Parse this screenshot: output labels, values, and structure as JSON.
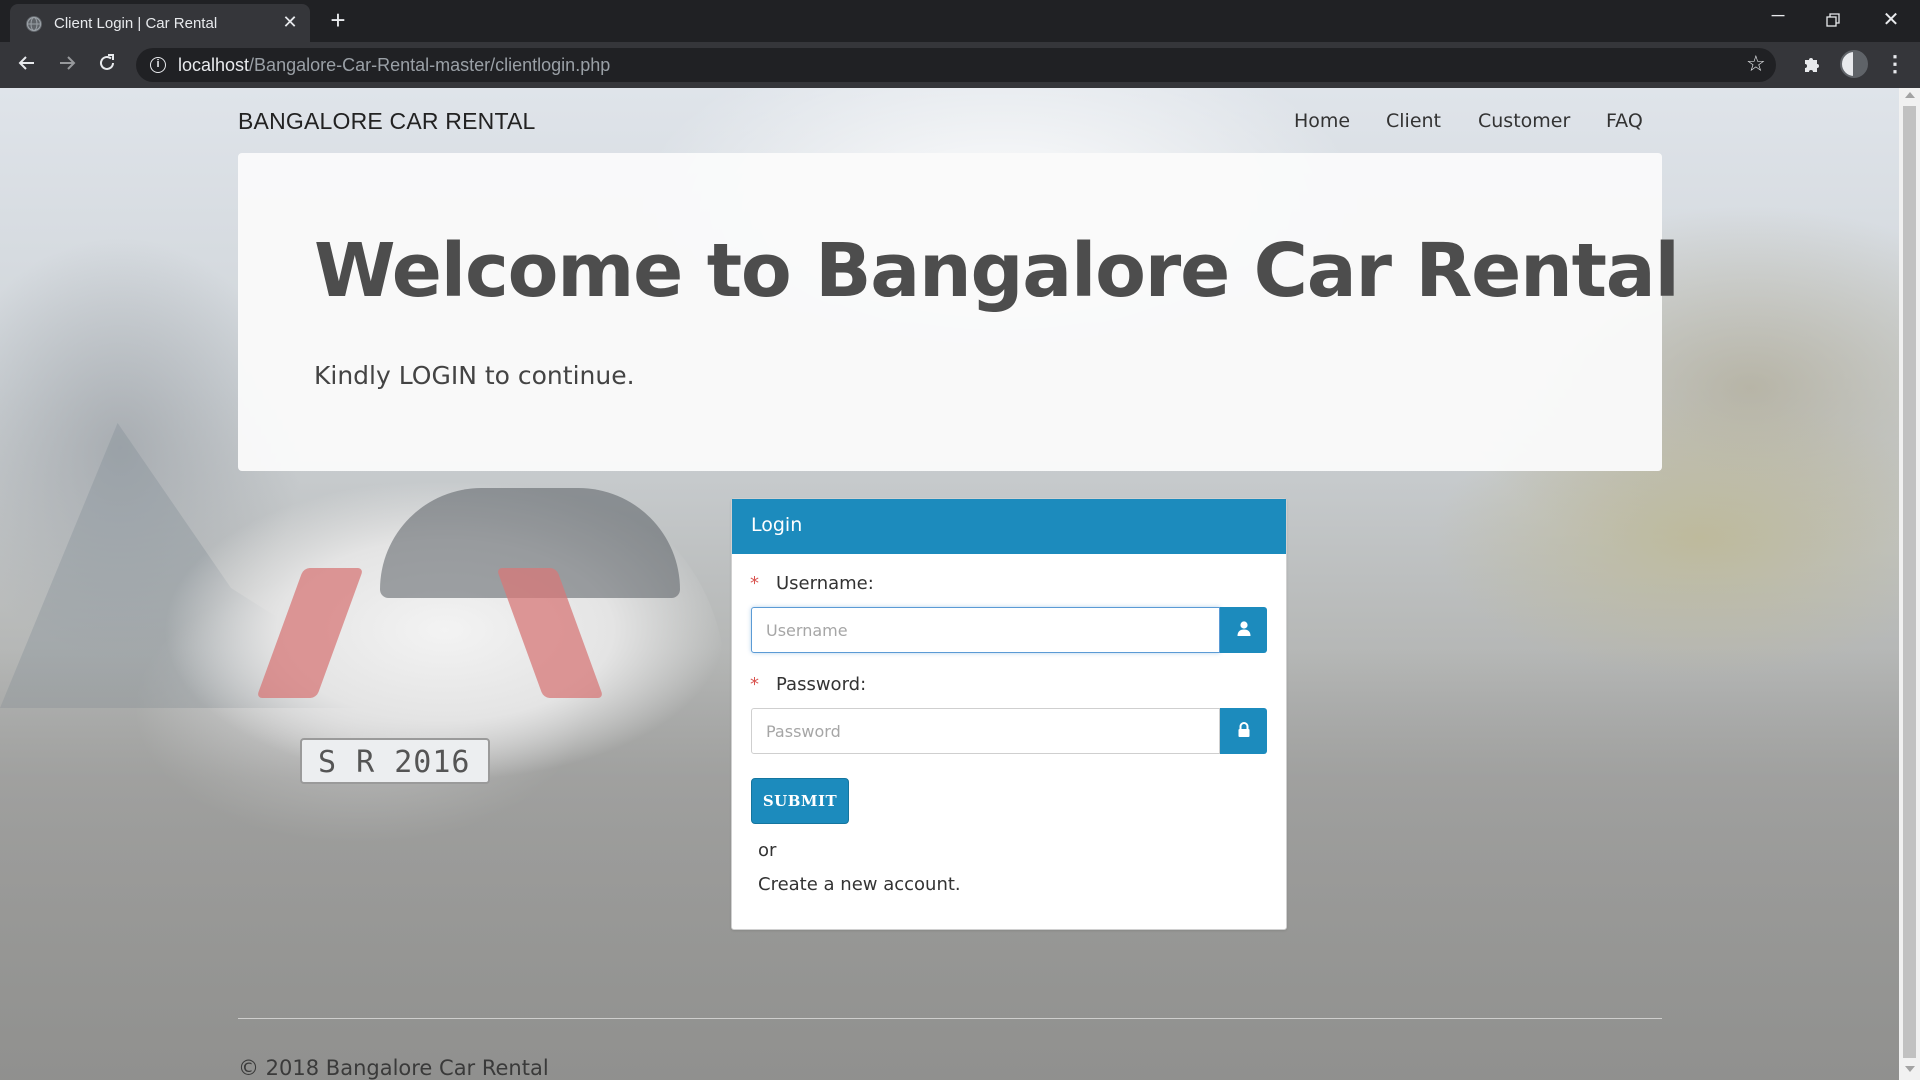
{
  "browser": {
    "tab_title": "Client Login | Car Rental",
    "url_host": "localhost",
    "url_path": "/Bangalore-Car-Rental-master/clientlogin.php",
    "icons": [
      "globe-icon",
      "close-icon",
      "plus-icon",
      "back-icon",
      "forward-icon",
      "reload-icon",
      "info-icon",
      "star-icon",
      "puzzle-icon",
      "avatar",
      "kebab-menu-icon"
    ],
    "glyphs": {
      "close": "✕",
      "plus": "+",
      "minimize": "─",
      "info": "i",
      "star": "☆",
      "menu": "⋮"
    }
  },
  "navbar": {
    "brand": "BANGALORE CAR RENTAL",
    "links": [
      "Home",
      "Client",
      "Customer",
      "FAQ"
    ]
  },
  "jumbotron": {
    "title": "Welcome to Bangalore Car Rental",
    "subtitle": "Kindly LOGIN to continue."
  },
  "login": {
    "heading": "Login",
    "required_mark": "*",
    "username_label": "Username:",
    "username_placeholder": "Username",
    "password_label": "Password:",
    "password_placeholder": "Password",
    "submit_label": "SUBMIT",
    "or_text": "or",
    "create_account_text": "Create a new account."
  },
  "background": {
    "plate_text": "S R 2016"
  },
  "footer": {
    "copyright": "© 2018 Bangalore Car Rental"
  },
  "colors": {
    "accent": "#1c8bbd",
    "required": "#d9534f",
    "browser_bg": "#202124",
    "browser_toolbar": "#35363a"
  }
}
